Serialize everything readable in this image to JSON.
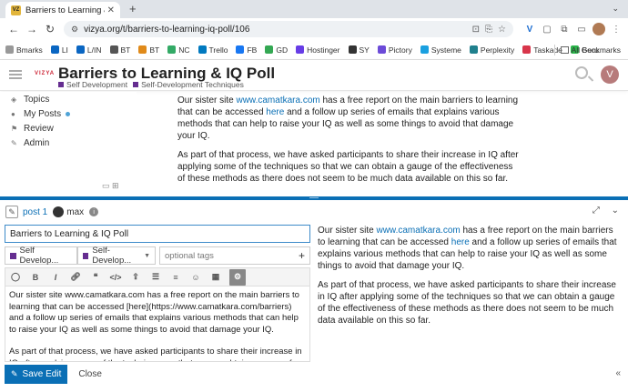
{
  "browser": {
    "tab_title": "Barriers to Learning & IQ Poll",
    "favicon_text": "VZ",
    "url": "vizya.org/t/barriers-to-learning-iq-poll/106",
    "bookmarks": [
      "Bmarks",
      "LI",
      "L/IN",
      "BT",
      "BT",
      "NC",
      "Trello",
      "FB",
      "GD",
      "Hostinger",
      "SY",
      "Pictory",
      "Systeme",
      "Perplexity",
      "Taskade",
      "Geru"
    ],
    "all_bookmarks": "All Bookmarks"
  },
  "header": {
    "logo": "VIZYA",
    "title": "Barriers to Learning & IQ Poll",
    "categories": [
      "Self Development",
      "Self-Development Techniques"
    ],
    "user_initial": "V"
  },
  "sidebar": {
    "items": [
      "Topics",
      "My Posts",
      "Review",
      "Admin"
    ]
  },
  "post": {
    "p1_a": "Our sister site ",
    "p1_link1": "www.camatkara.com",
    "p1_b": " has a free report on the main barriers to learning that can be accessed ",
    "p1_link2": "here",
    "p1_c": " and a follow up series of emails that explains various methods that can help to raise your IQ as well as some things to avoid that damage your IQ.",
    "p2": "As part of that process, we have asked participants to share their increase in IQ after applying some of the techniques so that we can obtain a gauge of the effectiveness of these methods as there does not seem to be much data available on this so far."
  },
  "composer": {
    "post_ref": "post 1",
    "reply_user": "max",
    "title_value": "Barriers to Learning & IQ Poll",
    "cat1": "Self Develop...",
    "cat2": "Self-Develop...",
    "tags_placeholder": "optional tags",
    "editor_p1": "Our sister site www.camatkara.com has a free report on the main barriers to learning that can be accessed [here](https://www.camatkara.com/barriers) and a follow up series of emails that explains various methods that can help to raise your IQ as well as some things to avoid that damage your IQ.",
    "editor_p2": "As part of that process, we have asked participants to share their increase in IQ after applying some of the techniques so that we can obtain a gauge of the effectiveness of these methods as there does not seem to be much data available on this so far.",
    "save_label": "Save Edit",
    "close_label": "Close"
  },
  "colors": {
    "accent": "#0a6fb5",
    "cat1": "#652d90",
    "cat2": "#652d90"
  }
}
